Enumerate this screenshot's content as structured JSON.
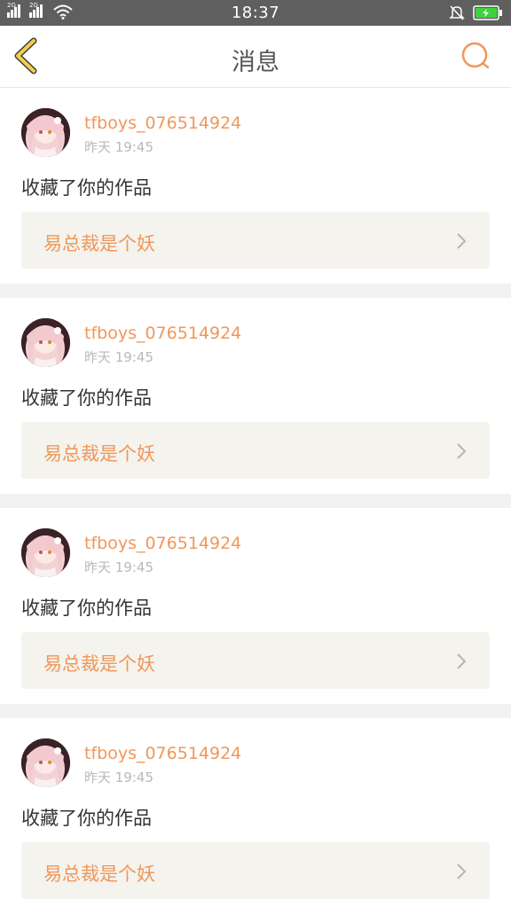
{
  "status_bar": {
    "time": "18:37",
    "sim1_label": "2G",
    "sim2_label": "2G",
    "icons": [
      "signal-icon",
      "signal-icon",
      "wifi-icon",
      "bell-muted-icon",
      "battery-charging-icon"
    ],
    "battery_color": "#3cd43c"
  },
  "header": {
    "title": "消息",
    "back_icon": "chevron-left-icon",
    "search_icon": "search-icon",
    "accent_color": "#f0975a"
  },
  "messages": [
    {
      "username": "tfboys_076514924",
      "time": "昨天 19:45",
      "action": "收藏了你的作品",
      "work_title": "易总裁是个妖"
    },
    {
      "username": "tfboys_076514924",
      "time": "昨天 19:45",
      "action": "收藏了你的作品",
      "work_title": "易总裁是个妖"
    },
    {
      "username": "tfboys_076514924",
      "time": "昨天 19:45",
      "action": "收藏了你的作品",
      "work_title": "易总裁是个妖"
    },
    {
      "username": "tfboys_076514924",
      "time": "昨天 19:45",
      "action": "收藏了你的作品",
      "work_title": "易总裁是个妖"
    }
  ]
}
